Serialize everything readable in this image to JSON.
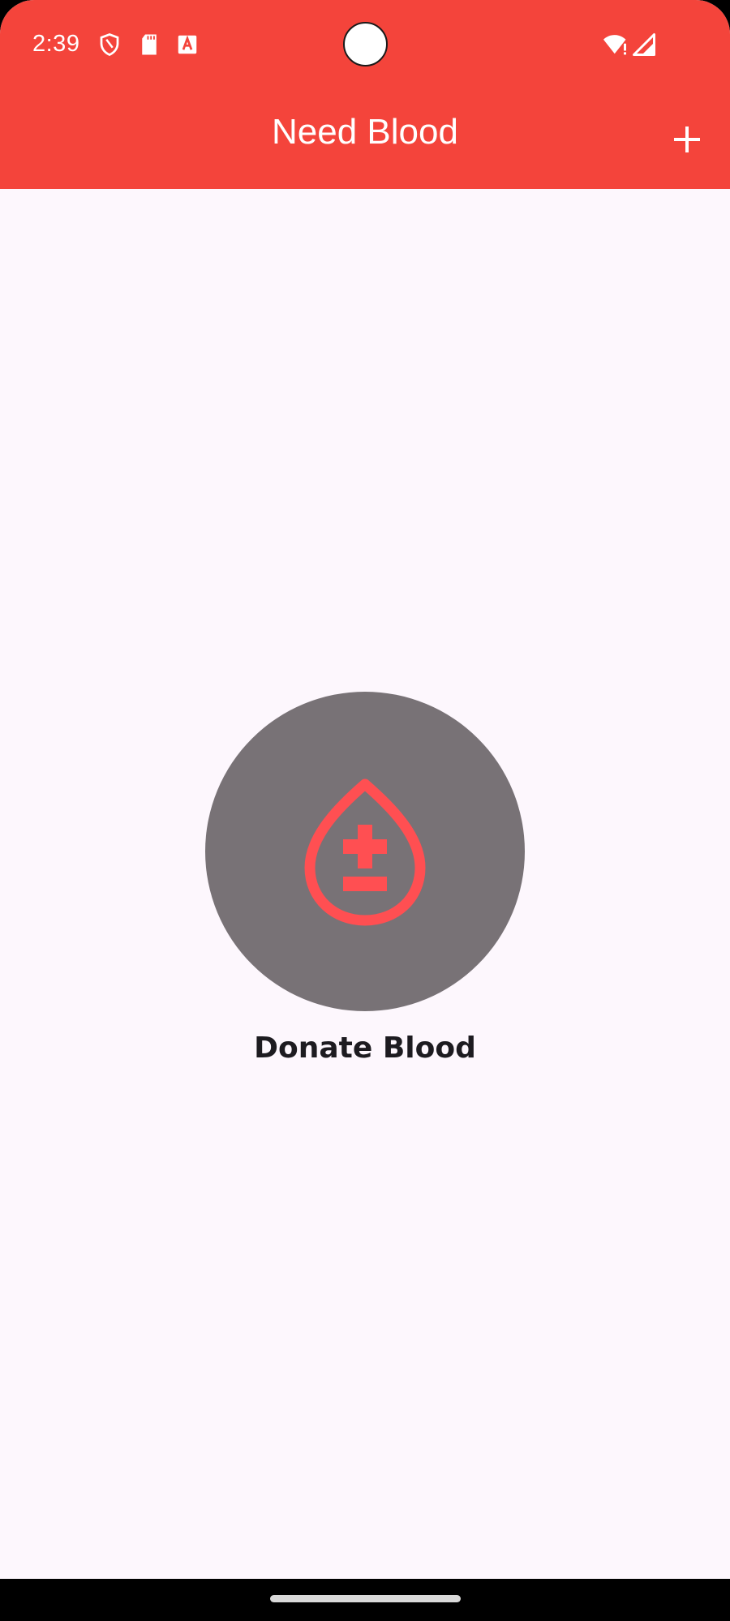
{
  "status_bar": {
    "time": "2:39",
    "icons": [
      "shield-icon",
      "sd-card-icon",
      "a-box-icon",
      "wifi-alert-icon",
      "signal-icon"
    ]
  },
  "app_bar": {
    "title": "Need Blood",
    "add_icon": "plus-icon",
    "background_color": "#f4443b"
  },
  "main": {
    "donate_label": "Donate Blood",
    "circle_color": "#787276",
    "drop_icon": "blood-drop-plus-minus-icon",
    "icon_color": "#ff4f52"
  }
}
